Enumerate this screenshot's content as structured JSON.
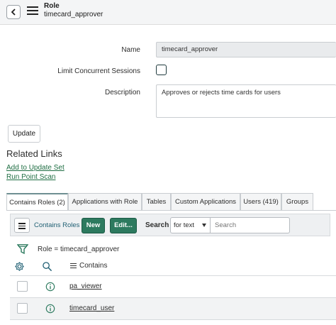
{
  "header": {
    "title": "Role",
    "subtitle": "timecard_approver"
  },
  "form": {
    "name_label": "Name",
    "name_value": "timecard_approver",
    "limit_label": "Limit Concurrent Sessions",
    "limit_checked": false,
    "description_label": "Description",
    "description_value": "Approves or rejects time cards for users",
    "update_label": "Update"
  },
  "related": {
    "title": "Related Links",
    "links": [
      "Add to Update Set",
      "Run Point Scan"
    ]
  },
  "tabs": [
    {
      "label": "Contains Roles (2)",
      "active": true
    },
    {
      "label": "Applications with Role",
      "active": false
    },
    {
      "label": "Tables",
      "active": false
    },
    {
      "label": "Custom Applications",
      "active": false
    },
    {
      "label": "Users (419)",
      "active": false
    },
    {
      "label": "Groups",
      "active": false
    }
  ],
  "list": {
    "toolbar_label": "Contains Roles",
    "new_label": "New",
    "edit_label": "Edit...",
    "search_label": "Search",
    "search_select": "for text",
    "search_placeholder": "Search",
    "filter_text": "Role = timecard_approver",
    "column_header": "Contains",
    "rows": [
      "pa_viewer",
      "timecard_user"
    ]
  },
  "colors": {
    "accent_green": "#2d7a5f",
    "link_green": "#1f6e43"
  },
  "icons": [
    "back-icon",
    "menu-icon",
    "filter-icon",
    "gear-icon",
    "search-icon",
    "info-icon"
  ]
}
